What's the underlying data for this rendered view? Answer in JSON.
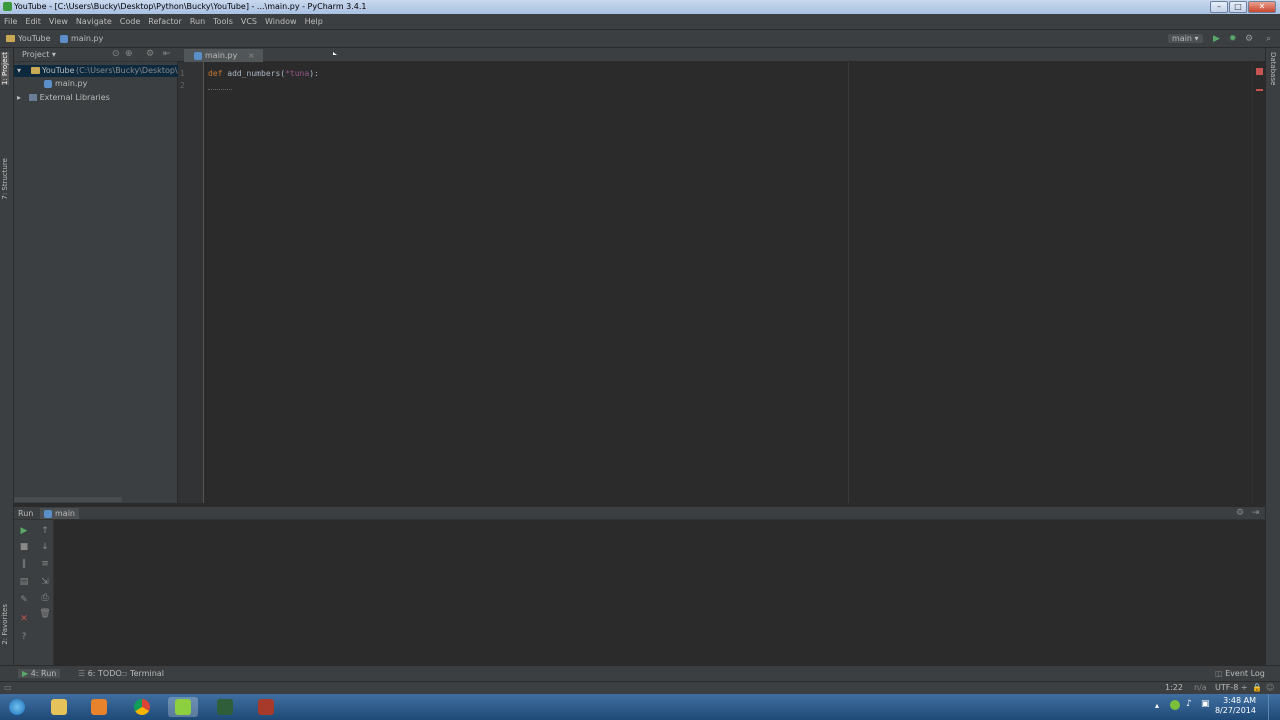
{
  "window": {
    "title": "YouTube - [C:\\Users\\Bucky\\Desktop\\Python\\Bucky\\YouTube] - ...\\main.py - PyCharm 3.4.1",
    "controls": [
      "–",
      "□",
      "✕"
    ]
  },
  "menu": [
    "File",
    "Edit",
    "View",
    "Navigate",
    "Code",
    "Refactor",
    "Run",
    "Tools",
    "VCS",
    "Window",
    "Help"
  ],
  "navbar": {
    "project": "YouTube",
    "file": "main.py",
    "run_config": "main"
  },
  "left_tool_tabs": [
    "1: Project",
    "7: Structure",
    "2: Favorites"
  ],
  "right_tool_tabs": [
    "Database"
  ],
  "project_panel": {
    "header": "Project",
    "root_label": "YouTube",
    "root_path": "(C:\\Users\\Bucky\\Desktop\\Py",
    "child_file": "main.py",
    "external": "External Libraries"
  },
  "editor": {
    "tab_label": "main.py",
    "line_numbers": [
      "1",
      "2"
    ],
    "code": {
      "keyword": "def",
      "function": "add_numbers",
      "open_paren": "(",
      "param": "*tuna",
      "close": "):"
    }
  },
  "run_panel": {
    "label": "Run",
    "config": "main"
  },
  "bottom_tabs": [
    "4: Run",
    "6: TODO",
    "Terminal"
  ],
  "status": {
    "event_log": "Event Log",
    "position": "1:22",
    "na": "n/a",
    "encoding": "UTF-8 ÷"
  },
  "taskbar": {
    "time": "3:48 AM",
    "date": "8/27/2014",
    "apps": [
      "windows-explorer",
      "media-player",
      "chrome",
      "pycharm",
      "app-green",
      "app-red"
    ]
  },
  "colors": {
    "ide_bg": "#2b2b2b",
    "panel_bg": "#3c3f41",
    "keyword": "#cc7832",
    "param": "#94558d",
    "text": "#a9b7c6",
    "taskbar": "#1f4a78"
  }
}
